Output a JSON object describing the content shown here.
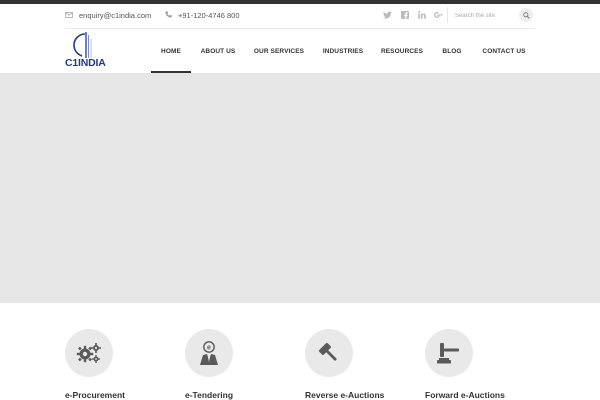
{
  "topbar": {
    "email": "enquiry@c1india.com",
    "phone": "+91-120-4746 800",
    "social": [
      {
        "icon": "twitter-icon"
      },
      {
        "icon": "facebook-icon"
      },
      {
        "icon": "linkedin-icon"
      },
      {
        "icon": "google-plus-icon"
      }
    ],
    "search": {
      "placeholder": "Search the site",
      "value": ""
    }
  },
  "logo": {
    "text": "C1INDIA",
    "color": "#1f3b8c"
  },
  "nav": {
    "items": [
      {
        "label": "HOME",
        "active": true
      },
      {
        "label": "ABOUT US",
        "active": false
      },
      {
        "label": "OUR SERVICES",
        "active": false
      },
      {
        "label": "INDUSTRIES",
        "active": false
      },
      {
        "label": "RESOURCES",
        "active": false
      },
      {
        "label": "BLOG",
        "active": false
      },
      {
        "label": "CONTACT US",
        "active": false
      }
    ]
  },
  "services": [
    {
      "title": "e-Procurement",
      "icon": "gears-icon"
    },
    {
      "title": "e-Tendering",
      "icon": "tender-person-icon"
    },
    {
      "title": "Reverse e-Auctions",
      "icon": "gavel-icon"
    },
    {
      "title": "Forward e-Auctions",
      "icon": "auction-hammer-icon"
    }
  ],
  "colors": {
    "banner": "#e6e6e6",
    "topstrip": "#333333",
    "icon_circle": "#e9e9e9"
  }
}
